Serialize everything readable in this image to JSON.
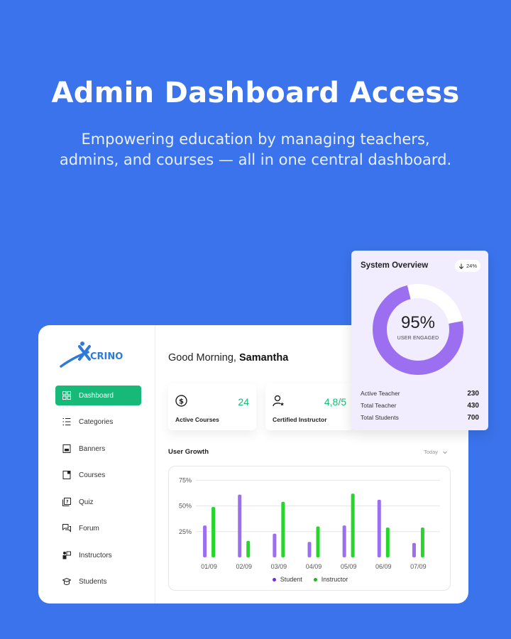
{
  "hero": {
    "title": "Admin Dashboard Access",
    "subtitle_line1": "Empowering education by managing teachers,",
    "subtitle_line2": "admins, and courses — all in one central dashboard."
  },
  "brand": {
    "name": "CRINO",
    "color": "#2f7ad9"
  },
  "colors": {
    "background": "#3b73ec",
    "accent_green": "#17b978",
    "student": "#9b6ff0",
    "instructor": "#26d62c"
  },
  "sidebar": {
    "items": [
      {
        "label": "Dashboard",
        "icon": "grid-icon",
        "active": true
      },
      {
        "label": "Categories",
        "icon": "list-icon",
        "active": false
      },
      {
        "label": "Banners",
        "icon": "banner-icon",
        "active": false
      },
      {
        "label": "Courses",
        "icon": "book-icon",
        "active": false
      },
      {
        "label": "Quiz",
        "icon": "quiz-icon",
        "active": false
      },
      {
        "label": "Forum",
        "icon": "chat-icon",
        "active": false
      },
      {
        "label": "Instructors",
        "icon": "instructor-icon",
        "active": false
      },
      {
        "label": "Students",
        "icon": "graduation-cap-icon",
        "active": false
      }
    ]
  },
  "header": {
    "greeting": "Good Morning,",
    "user_name": "Samantha"
  },
  "stats": [
    {
      "label": "Active Courses",
      "value": "24",
      "icon": "dollar-circle-icon"
    },
    {
      "label": "Certified Instructor",
      "value": "4,8/5",
      "icon": "user-star-icon"
    }
  ],
  "user_growth": {
    "title": "User Growth",
    "range_label": "Today"
  },
  "chart_data": {
    "type": "bar",
    "categories": [
      "01/09",
      "02/09",
      "03/09",
      "04/09",
      "05/09",
      "06/09",
      "07/09"
    ],
    "series": [
      {
        "name": "Student",
        "values": [
          31,
          61,
          23,
          15,
          31,
          56,
          14
        ]
      },
      {
        "name": "Instructor",
        "values": [
          49,
          16,
          54,
          30,
          62,
          29,
          29
        ]
      }
    ],
    "y_ticks": [
      "25%",
      "50%",
      "75%"
    ],
    "ylim": [
      0,
      75
    ],
    "grid": true,
    "legend": "bottom"
  },
  "overview": {
    "title": "System Overview",
    "change": "24%",
    "engaged_percent": "95%",
    "engaged_value": 95,
    "engaged_label": "USER ENGAGED",
    "rows": [
      {
        "label": "Active Teacher",
        "value": "230"
      },
      {
        "label": "Total Teacher",
        "value": "430"
      },
      {
        "label": "Total Students",
        "value": "700"
      }
    ]
  }
}
